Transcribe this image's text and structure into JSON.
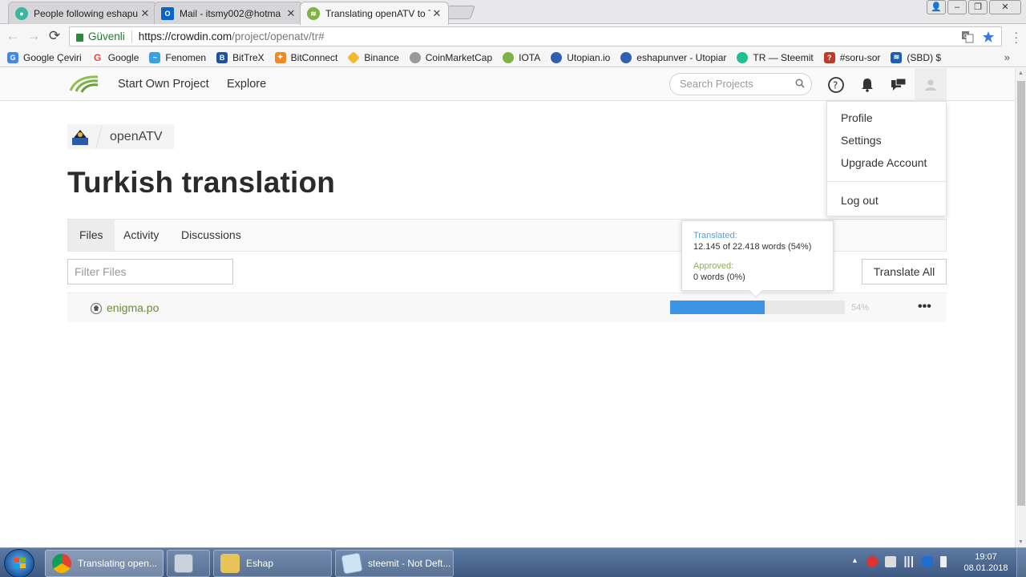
{
  "browser": {
    "tabs": [
      {
        "title": "People following eshapu",
        "favicon_color": "#3cb4a0"
      },
      {
        "title": "Mail - itsmy002@hotma",
        "favicon_color": "#0a64c8"
      },
      {
        "title": "Translating openATV to T",
        "favicon_color": "#7cb342"
      }
    ],
    "omnibox": {
      "secure_label": "Güvenli",
      "url_host": "https://crowdin.com",
      "url_path": "/project/openatv/tr#"
    },
    "bookmarks": [
      {
        "label": "Google Çeviri",
        "icon": "google-translate-icon",
        "color": "#4285f4"
      },
      {
        "label": "Google",
        "icon": "google-icon",
        "color": "#ea4335"
      },
      {
        "label": "Fenomen",
        "icon": "fenomen-icon",
        "color": "#3aa0e0"
      },
      {
        "label": "BitTreX",
        "icon": "bittrex-icon",
        "color": "#1f4fa0"
      },
      {
        "label": "BitConnect",
        "icon": "bitconnect-icon",
        "color": "#f08a24"
      },
      {
        "label": "Binance",
        "icon": "binance-icon",
        "color": "#f3ba2f"
      },
      {
        "label": "CoinMarketCap",
        "icon": "coinmarketcap-icon",
        "color": "#9a9a9a"
      },
      {
        "label": "IOTA",
        "icon": "iota-icon",
        "color": "#7cb342"
      },
      {
        "label": "Utopian.io",
        "icon": "utopian-icon",
        "color": "#3060b0"
      },
      {
        "label": "eshapunver - Utopiar",
        "icon": "utopian-icon",
        "color": "#3060b0"
      },
      {
        "label": "TR — Steemit",
        "icon": "steemit-icon",
        "color": "#1fbf8f"
      },
      {
        "label": "#soru-sor",
        "icon": "soru-sor-icon",
        "color": "#c0392b"
      },
      {
        "label": "(SBD) $",
        "icon": "steem-icon",
        "color": "#1a5fb4"
      }
    ]
  },
  "crowdin": {
    "nav": {
      "start_project": "Start Own Project",
      "explore": "Explore",
      "search_placeholder": "Search Projects"
    },
    "breadcrumb": {
      "project": "openATV"
    },
    "page_title": "Turkish translation",
    "tabs": [
      "Files",
      "Activity",
      "Discussions"
    ],
    "filter_placeholder": "Filter Files",
    "translate_all": "Translate All",
    "files": [
      {
        "name": "enigma.po",
        "progress_fraction": 0.54,
        "percent_label": "54%"
      }
    ],
    "tooltip": {
      "translated_label": "Translated:",
      "translated_value": "12.145 of 22.418 words (54%)",
      "approved_label": "Approved:",
      "approved_value": "0 words (0%)"
    },
    "user_menu": [
      "Profile",
      "Settings",
      "Upgrade Account",
      "Log out"
    ],
    "accent_color": "#3e94e4"
  },
  "taskbar": {
    "buttons": [
      {
        "label": "Translating open...",
        "icon": "chrome-icon"
      },
      {
        "label": "",
        "icon": "calculator-icon"
      },
      {
        "label": "Eshap",
        "icon": "folder-icon"
      },
      {
        "label": "steemit - Not Deft...",
        "icon": "notepad-icon"
      }
    ],
    "time": "19:07",
    "date": "08.01.2018"
  }
}
